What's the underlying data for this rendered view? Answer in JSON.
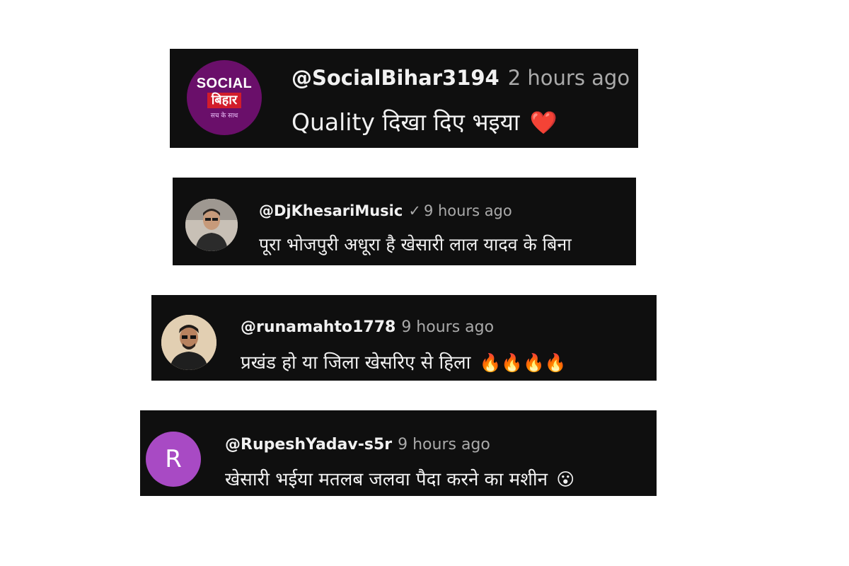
{
  "comments": [
    {
      "handle": "@SocialBihar3194",
      "time": "2 hours ago",
      "text": "Quality दिखा दिए भइया",
      "emoji": "❤️",
      "avatar": {
        "kind": "logo",
        "line1": "SOCIAL",
        "line2": "बिहार",
        "tagline": "सच के साथ"
      }
    },
    {
      "handle": "@DjKhesariMusic",
      "verified_icon": "✓",
      "time": "9 hours ago",
      "text": "पूरा भोजपुरी अधूरा है खेसारी लाल यादव के बिना",
      "avatar": {
        "kind": "photo"
      }
    },
    {
      "handle": "@runamahto1778",
      "time": "9 hours ago",
      "text": "प्रखंड हो या जिला खेसरिए से हिला",
      "emoji": "🔥🔥🔥🔥",
      "avatar": {
        "kind": "photo"
      }
    },
    {
      "handle": "@RupeshYadav-s5r",
      "time": "9 hours ago",
      "text": "खेसारी भईया मतलब जलवा पैदा करने का मशीन",
      "emoji": "😮",
      "avatar": {
        "kind": "initial",
        "letter": "R",
        "color": "#a84ac4"
      }
    }
  ],
  "colors": {
    "card_bg": "#0f0f0f",
    "text": "#f1f1f1",
    "muted": "#aaaaaa"
  }
}
